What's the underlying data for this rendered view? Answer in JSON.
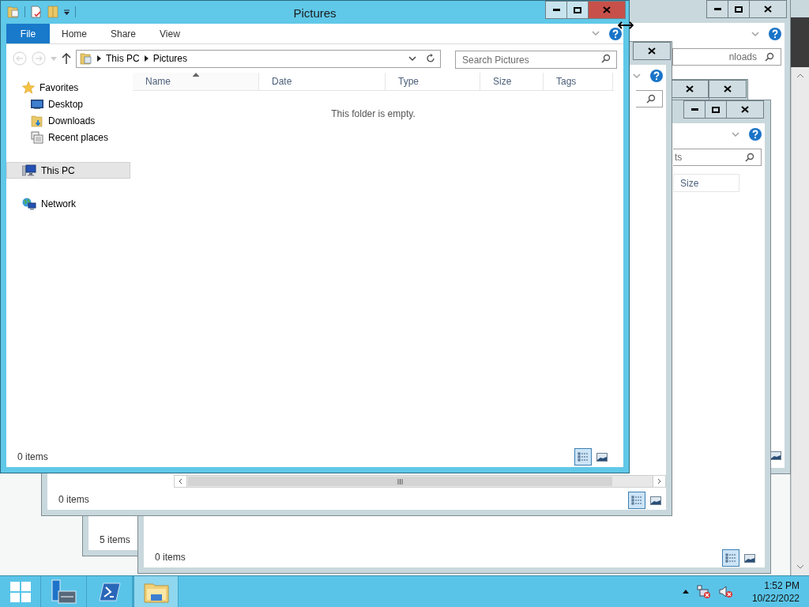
{
  "background_windows": [
    {
      "search_text": "nloads"
    },
    {
      "status": "0 items"
    },
    {
      "status": "5 items"
    },
    {
      "search_text": "ts",
      "column": "Size",
      "status": "0 items"
    }
  ],
  "main_window": {
    "title": "Pictures",
    "file_tab": "File",
    "tabs": [
      {
        "label": "Home",
        "selected": false
      },
      {
        "label": "Share",
        "selected": false
      },
      {
        "label": "View",
        "selected": false
      }
    ],
    "breadcrumb": [
      "This PC",
      "Pictures"
    ],
    "search": {
      "placeholder": "Search Pictures"
    },
    "columns": [
      {
        "label": "Name",
        "sorted": true
      },
      {
        "label": "Date",
        "sorted": false
      },
      {
        "label": "Type",
        "sorted": false
      },
      {
        "label": "Size",
        "sorted": false
      },
      {
        "label": "Tags",
        "sorted": false
      }
    ],
    "empty_message": "This folder is empty.",
    "nav": [
      {
        "label": "Favorites",
        "kind": "star",
        "selected": false,
        "children": [
          {
            "label": "Desktop",
            "kind": "desktop",
            "selected": false
          },
          {
            "label": "Downloads",
            "kind": "downloads",
            "selected": false
          },
          {
            "label": "Recent places",
            "kind": "recent",
            "selected": false
          }
        ]
      },
      {
        "label": "This PC",
        "kind": "pc",
        "selected": true
      },
      {
        "label": "Network",
        "kind": "network",
        "selected": false
      }
    ],
    "status": "0 items",
    "views": [
      {
        "kind": "details",
        "selected": true
      },
      {
        "kind": "preview",
        "selected": false
      }
    ]
  },
  "taskbar": {
    "apps": [
      {
        "kind": "server-manager",
        "selected": false
      },
      {
        "kind": "powershell",
        "selected": false
      },
      {
        "kind": "explorer",
        "selected": true
      }
    ],
    "time": "1:52 PM",
    "date": "10/22/2022"
  }
}
